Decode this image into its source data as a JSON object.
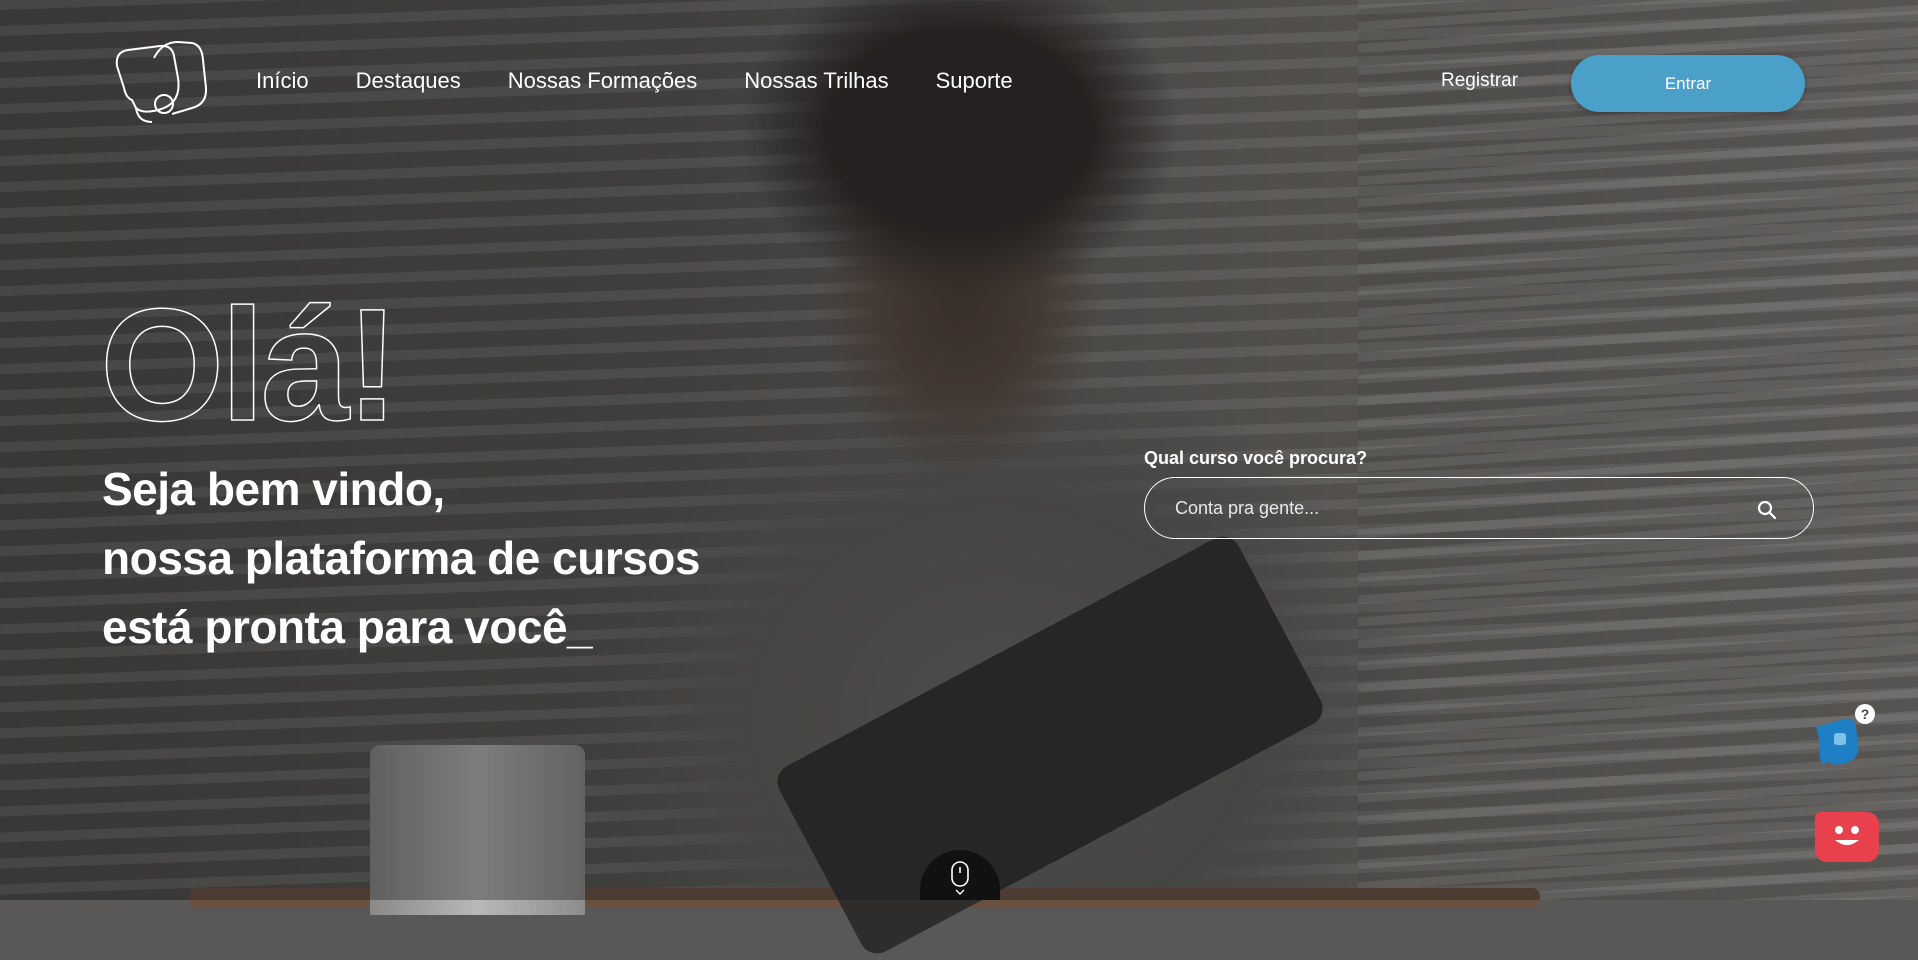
{
  "nav": {
    "items": [
      {
        "label": "Início"
      },
      {
        "label": "Destaques"
      },
      {
        "label": "Nossas Formações"
      },
      {
        "label": "Nossas Trilhas"
      },
      {
        "label": "Suporte"
      }
    ]
  },
  "auth": {
    "register_label": "Registrar",
    "enter_label": "Entrar"
  },
  "hero": {
    "greeting": "Olá!",
    "welcome_lines": [
      "Seja bem vindo,",
      "nossa plataforma de cursos",
      "está pronta para você_"
    ]
  },
  "search": {
    "label": "Qual curso você procura?",
    "placeholder": "Conta pra gente...",
    "value": ""
  },
  "widgets": {
    "help_badge": "?"
  },
  "colors": {
    "accent": "#4aa0c8",
    "chat": "#e8414d",
    "help_blue": "#1e7fc4"
  },
  "icons": {
    "logo": "logo-icon",
    "search": "search-icon",
    "help": "help-icon",
    "chat": "chat-icon",
    "scroll": "mouse-scroll-icon"
  }
}
